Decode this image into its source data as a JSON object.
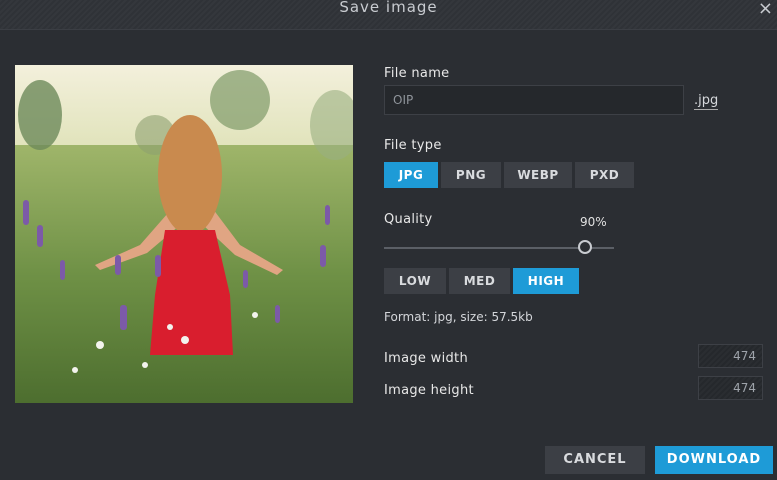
{
  "dialog": {
    "title": "Save image",
    "close_symbol": "×"
  },
  "filename": {
    "label": "File name",
    "value": "OIP",
    "extension": ".jpg"
  },
  "filetype": {
    "label": "File type",
    "options": [
      "JPG",
      "PNG",
      "WEBP",
      "PXD"
    ],
    "selected": "JPG"
  },
  "quality": {
    "label": "Quality",
    "value_text": "90%",
    "value": 0.9,
    "presets": [
      "LOW",
      "MED",
      "HIGH"
    ],
    "selected_preset": "HIGH"
  },
  "info": {
    "format_text": "Format: jpg, size: 57.5kb"
  },
  "dimensions": {
    "width_label": "Image width",
    "width_value": "474",
    "height_label": "Image height",
    "height_value": "474"
  },
  "actions": {
    "cancel": "CANCEL",
    "download": "DOWNLOAD"
  },
  "colors": {
    "accent": "#1e9bd7",
    "panel": "#2b2e33",
    "button": "#3c3f45"
  }
}
